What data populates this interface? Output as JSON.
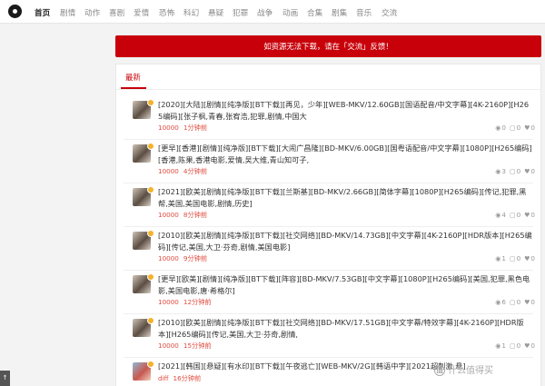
{
  "nav": {
    "items": [
      "首页",
      "剧情",
      "动作",
      "喜剧",
      "爱情",
      "恐怖",
      "科幻",
      "悬疑",
      "犯罪",
      "战争",
      "动画",
      "合集",
      "剧集",
      "音乐",
      "交流"
    ],
    "active_index": 0
  },
  "notice": "如资源无法下载，请在「交流」反馈！",
  "panel": {
    "tab_label": "最新"
  },
  "posts": [
    {
      "title": "[2020][大陆][剧情][纯净版][BT下载][再见，少年][WEB-MKV/12.60GB][国语配音/中文字幕][4K-2160P][H265编码][张子枫,青春,张宥浩,犯罪,剧情,中国大",
      "author": "10000",
      "time": "1分钟前",
      "views": "0",
      "comments": "0",
      "likes": "0"
    },
    {
      "title": "[更早][香港][剧情][纯净版][BT下载][大闹广昌隆][BD-MKV/6.00GB][国粤语配音/中文字幕][1080P][H265编码][香港,陈果,香港电影,爱情,吴大维,青山知可子,",
      "author": "10000",
      "time": "4分钟前",
      "views": "3",
      "comments": "0",
      "likes": "0"
    },
    {
      "title": "[2021][欧美][剧情][纯净版][BT下载][兰斯基][BD-MKV/2.66GB][简体字幕][1080P][H265编码][传记,犯罪,黑帮,美国,美国电影,剧情,历史]",
      "author": "10000",
      "time": "8分钟前",
      "views": "4",
      "comments": "0",
      "likes": "0"
    },
    {
      "title": "[2010][欧美][剧情][纯净版][BT下载][社交网络][BD-MKV/14.73GB][中文字幕][4K-2160P][HDR版本][H265编码][传记,美国,大卫·芬奇,剧情,美国电影]",
      "author": "10000",
      "time": "9分钟前",
      "views": "1",
      "comments": "0",
      "likes": "0"
    },
    {
      "title": "[更早][欧美][剧情][纯净版][BT下载][阵容][BD-MKV/7.53GB][中文字幕][1080P][H265编码][美国,犯罪,黑色电影,美国电影,唐·希格尔]",
      "author": "10000",
      "time": "12分钟前",
      "views": "6",
      "comments": "0",
      "likes": "0"
    },
    {
      "title": "[2010][欧美][剧情][纯净版][BT下载][社交网络][BD-MKV/17.51GB][中文字幕/特效字幕][4K-2160P][HDR版本][H265编码][传记,美国,大卫·芬奇,剧情,",
      "author": "10000",
      "time": "15分钟前",
      "views": "1",
      "comments": "0",
      "likes": "0"
    },
    {
      "title": "[2021][韩国][悬疑][有水印][BT下载][午夜逃亡][WEB-MKV/2G][韩语中字][2021超刺激  悬]",
      "author": "diff",
      "time": "16分钟前",
      "views": "",
      "comments": "",
      "likes": ""
    }
  ],
  "watermark": {
    "text": "什么值得买",
    "icon": "值"
  },
  "scroll_up": "↑"
}
